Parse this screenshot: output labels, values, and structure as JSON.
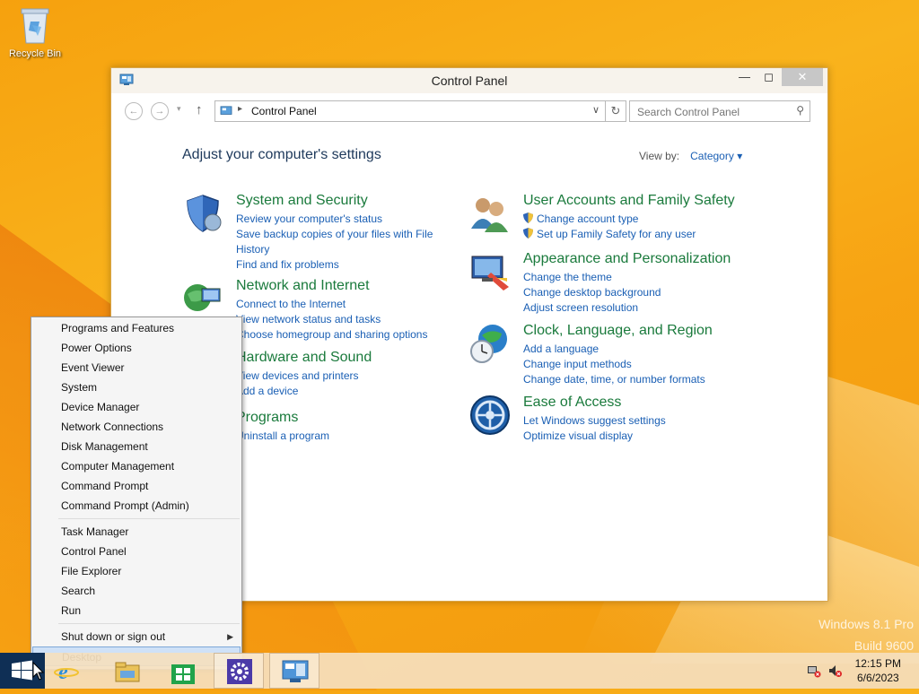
{
  "desktop": {
    "recycle_bin_label": "Recycle Bin",
    "watermark_line1": "Windows 8.1 Pro",
    "watermark_line2": "Build 9600"
  },
  "window": {
    "title": "Control Panel",
    "address": {
      "crumb": "Control Panel"
    },
    "search": {
      "placeholder": "Search Control Panel"
    },
    "heading": "Adjust your computer's settings",
    "view_by_label": "View by:",
    "view_by_value": "Category",
    "categories_left": [
      {
        "title": "System and Security",
        "icon": "shield-icon",
        "links": [
          "Review your computer's status",
          "Save backup copies of your files with File",
          "History",
          "Find and fix problems"
        ]
      },
      {
        "title": "Network and Internet",
        "icon": "globe-network-icon",
        "links": [
          "Connect to the Internet",
          "View network status and tasks",
          "Choose homegroup and sharing options"
        ]
      },
      {
        "title": "Hardware and Sound",
        "icon": "printer-icon",
        "links": [
          "View devices and printers",
          "Add a device"
        ]
      },
      {
        "title": "Programs",
        "icon": "programs-icon",
        "links": [
          "Uninstall a program"
        ]
      }
    ],
    "categories_right": [
      {
        "title": "User Accounts and Family Safety",
        "icon": "users-icon",
        "links": [
          "Change account type",
          "Set up Family Safety for any user"
        ]
      },
      {
        "title": "Appearance and Personalization",
        "icon": "monitor-paint-icon",
        "links": [
          "Change the theme",
          "Change desktop background",
          "Adjust screen resolution"
        ]
      },
      {
        "title": "Clock, Language, and Region",
        "icon": "clock-globe-icon",
        "links": [
          "Add a language",
          "Change input methods",
          "Change date, time, or number formats"
        ]
      },
      {
        "title": "Ease of Access",
        "icon": "ease-access-icon",
        "links": [
          "Let Windows suggest settings",
          "Optimize visual display"
        ]
      }
    ]
  },
  "context_menu": {
    "items": [
      "Programs and Features",
      "Power Options",
      "Event Viewer",
      "System",
      "Device Manager",
      "Network Connections",
      "Disk Management",
      "Computer Management",
      "Command Prompt",
      "Command Prompt (Admin)",
      "Task Manager",
      "Control Panel",
      "File Explorer",
      "Search",
      "Run",
      "Shut down or sign out",
      "Desktop"
    ],
    "highlighted": "Desktop"
  },
  "taskbar": {
    "time": "12:15 PM",
    "date": "6/6/2023"
  },
  "colors": {
    "accent_blue": "#1a5fb4",
    "category_green": "#1a7a3c",
    "heading_navy": "#1e395b",
    "start_bg": "#0f2f55"
  }
}
